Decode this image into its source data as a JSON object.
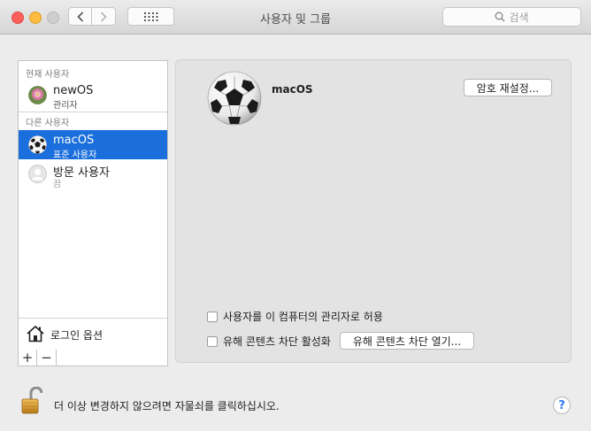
{
  "window": {
    "title": "사용자 및 그룹"
  },
  "toolbar": {
    "search_placeholder": "검색"
  },
  "sidebar": {
    "current_header": "현재 사용자",
    "other_header": "다른 사용자",
    "current_user": {
      "name": "newOS",
      "role": "관리자"
    },
    "other_users": [
      {
        "name": "macOS",
        "role": "표준 사용자",
        "selected": true
      },
      {
        "name": "방문 사용자",
        "role": "끔",
        "selected": false
      }
    ],
    "login_options": "로그인 옵션",
    "add_label": "+",
    "remove_label": "−"
  },
  "main": {
    "user_name": "macOS",
    "reset_password_button": "암호 재설정...",
    "allow_admin_label": "사용자를 이 컴퓨터의 관리자로 허용",
    "parental_label": "유해 콘텐츠 차단 활성화",
    "parental_button": "유해 콘텐츠 차단 열기..."
  },
  "footer": {
    "lock_text": "더 이상 변경하지 않으려면 자물쇠를 클릭하십시오.",
    "help_label": "?"
  },
  "colors": {
    "selection": "#1a6fdc",
    "close": "#fc605b",
    "minimize": "#fdbc40"
  }
}
